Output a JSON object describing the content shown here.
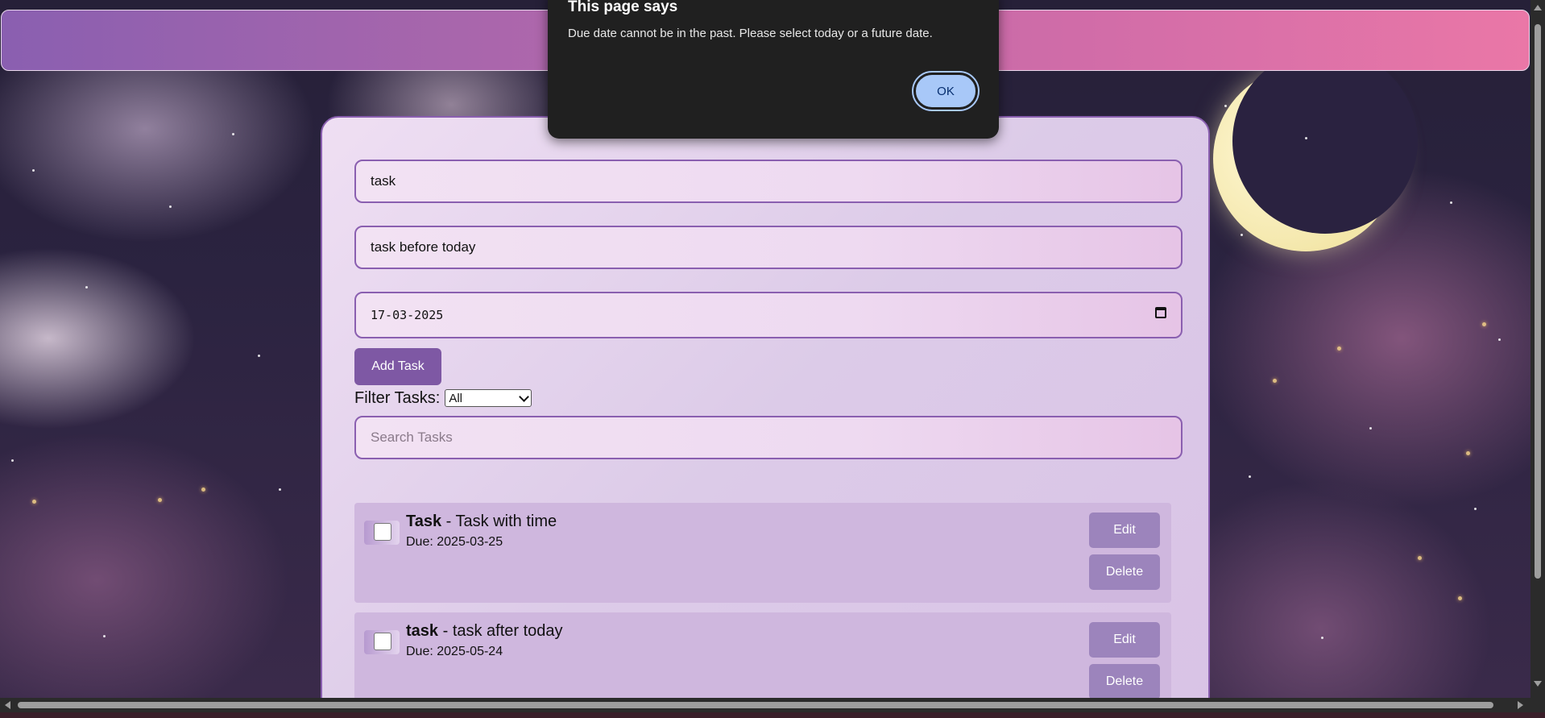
{
  "dialog": {
    "title": "This page says",
    "message": "Due date cannot be in the past. Please select today or a future date.",
    "ok_label": "OK"
  },
  "form": {
    "title_value": "task",
    "description_value": "task before today",
    "date_value": "17-03-2025",
    "add_label": "Add Task",
    "filter_label": "Filter Tasks:",
    "filter_selected": "All",
    "search_placeholder": "Search Tasks"
  },
  "tasks": [
    {
      "name": "Task",
      "separator": " - ",
      "description": "Task with time",
      "due": "Due: 2025-03-25",
      "edit_label": "Edit",
      "delete_label": "Delete"
    },
    {
      "name": "task",
      "separator": " - ",
      "description": "task after today",
      "due": "Due: 2025-05-24",
      "edit_label": "Edit",
      "delete_label": "Delete"
    }
  ],
  "colors": {
    "accent": "#8a5fb0",
    "header_start": "#8a5fb0",
    "header_end": "#ea77a7",
    "button": "#7e58a4",
    "task_button": "#9c84bc",
    "dialog_bg": "#202020",
    "ok_button": "#a8c8f8"
  },
  "icons": [
    "calendar-icon",
    "chevron-down-icon",
    "checkbox-icon",
    "moon-icon"
  ]
}
